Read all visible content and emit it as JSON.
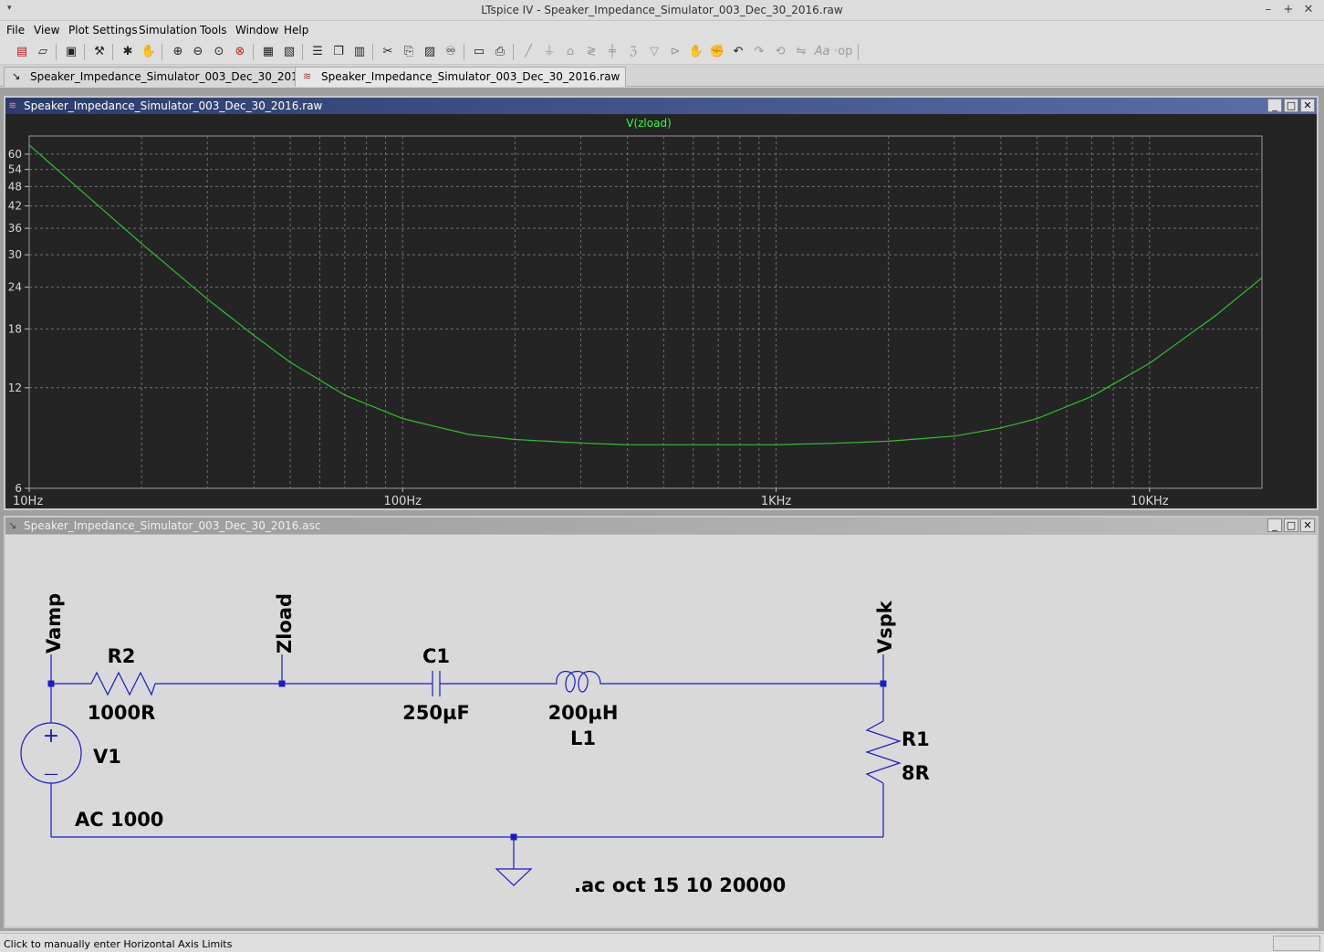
{
  "window": {
    "title": "LTspice IV - Speaker_Impedance_Simulator_003_Dec_30_2016.raw",
    "sys_menu_glyph": "▾",
    "minimize": "–",
    "maximize": "+",
    "close": "✕"
  },
  "menubar": {
    "items": [
      "File",
      "View",
      "Plot Settings",
      "Simulation",
      "Tools",
      "Window",
      "Help"
    ]
  },
  "toolbar": {
    "icons": [
      "new-schematic",
      "open",
      "save",
      "control-panel",
      "run",
      "halt",
      "zoom-in",
      "zoom-out",
      "zoom-full",
      "zoom-cancel",
      "autorange",
      "pick-visible-traces",
      "tile-horizontal",
      "cascade",
      "tile-vertical",
      "cut",
      "copy",
      "paste",
      "find",
      "print-setup",
      "print",
      "wire",
      "ground",
      "label-net",
      "resistor",
      "capacitor",
      "inductor",
      "diode",
      "component",
      "move",
      "drag",
      "undo",
      "redo",
      "rotate",
      "mirror",
      "text",
      "spice-directive"
    ]
  },
  "tabs": [
    {
      "label": "Speaker_Impedance_Simulator_003_Dec_30_2016.asc",
      "icon": "schematic-icon"
    },
    {
      "label": "Speaker_Impedance_Simulator_003_Dec_30_2016.raw",
      "icon": "waveform-icon"
    }
  ],
  "plot_window": {
    "title": "Speaker_Impedance_Simulator_003_Dec_30_2016.raw",
    "restore": "_",
    "maximize": "□",
    "close": "✕"
  },
  "chart_data": {
    "type": "line",
    "title": "V(zload)",
    "xscale": "log",
    "yscale": "log",
    "xlim": [
      10,
      20000
    ],
    "ylim": [
      6,
      68
    ],
    "x_tick_labels": [
      "10Hz",
      "100Hz",
      "1KHz",
      "10KHz"
    ],
    "x_ticks": [
      10,
      100,
      1000,
      10000
    ],
    "y_tick_labels": [
      "6",
      "12",
      "18",
      "24",
      "30",
      "36",
      "42",
      "48",
      "54",
      "60"
    ],
    "y_ticks": [
      6,
      12,
      18,
      24,
      30,
      36,
      42,
      48,
      54,
      60
    ],
    "grid": true,
    "series": [
      {
        "name": "V(zload)",
        "color": "#30c030",
        "x": [
          10,
          15,
          20,
          30,
          40,
          50,
          70,
          100,
          150,
          200,
          300,
          400,
          500,
          700,
          1000,
          1500,
          2000,
          3000,
          4000,
          5000,
          7000,
          10000,
          15000,
          20000
        ],
        "y": [
          63.9,
          42.9,
          32.4,
          22.1,
          17.2,
          14.3,
          11.4,
          9.7,
          8.7,
          8.4,
          8.2,
          8.1,
          8.1,
          8.1,
          8.1,
          8.2,
          8.3,
          8.6,
          9.1,
          9.7,
          11.3,
          14.2,
          19.7,
          25.6
        ]
      }
    ]
  },
  "schematic_window": {
    "title": "Speaker_Impedance_Simulator_003_Dec_30_2016.asc",
    "restore": "_",
    "maximize": "□",
    "close": "✕"
  },
  "schematic": {
    "labels": {
      "vamp": "Vamp",
      "zload": "Zload",
      "vspk": "Vspk",
      "r2_name": "R2",
      "r2_value": "1000R",
      "c1_name": "C1",
      "c1_value": "250µF",
      "l1_value": "200µH",
      "l1_name": "L1",
      "r1_name": "R1",
      "r1_value": "8R",
      "v1_name": "V1",
      "v1_value": "AC 1000",
      "directive": ".ac oct 15 10 20000",
      "plus": "+",
      "minus": "—"
    },
    "wire_color": "#1a1ac8",
    "text_color": "#000000"
  },
  "statusbar": {
    "text": "Click to manually enter Horizontal Axis Limits"
  }
}
